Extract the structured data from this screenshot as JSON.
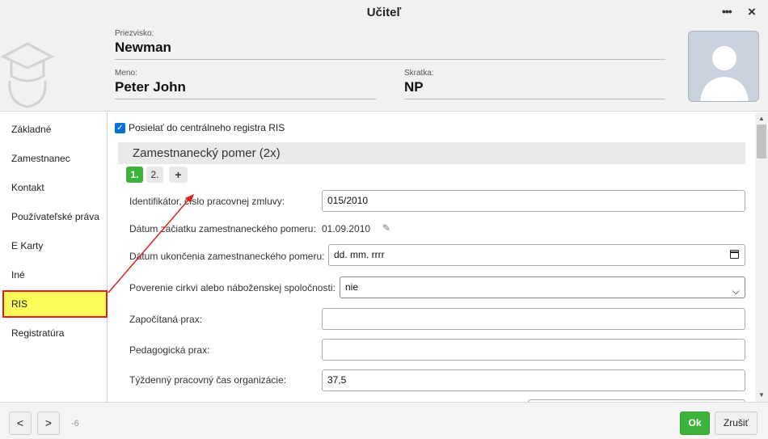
{
  "window": {
    "title": "Učiteľ",
    "more_icon": "more-dots-icon",
    "close_icon": "close-icon"
  },
  "header": {
    "surname": {
      "label": "Priezvisko:",
      "value": "Newman"
    },
    "name": {
      "label": "Meno:",
      "value": "Peter John"
    },
    "abbr": {
      "label": "Skratka:",
      "value": "NP"
    }
  },
  "sidebar": {
    "items": [
      {
        "label": "Základné"
      },
      {
        "label": "Zamestnanec"
      },
      {
        "label": "Kontakt"
      },
      {
        "label": "Používateľské práva"
      },
      {
        "label": "E Karty"
      },
      {
        "label": "Iné"
      },
      {
        "label": "RIS",
        "active": true
      },
      {
        "label": "Registratúra"
      }
    ],
    "highlight_color": "#fbfb5a",
    "highlight_border": "#e0201c"
  },
  "content": {
    "send_checkbox": {
      "label": "Posielať do centrálneho registra RIS",
      "checked": true
    },
    "section_title": "Zamestnanecký pomer (2x)",
    "pager": {
      "p1": "1.",
      "p2": "2.",
      "add": "+"
    },
    "fields": {
      "contract_id": {
        "label": "Identifikátor, číslo pracovnej zmluvy:",
        "value": "015/2010"
      },
      "start_date": {
        "label": "Dátum začiatku zamestnaneckého pomeru:",
        "value": "01.09.2010"
      },
      "end_date": {
        "label": "Dátum ukončenia zamestnaneckého pomeru:",
        "placeholder": "dd. mm. rrrr"
      },
      "church_mandate": {
        "label": "Poverenie cirkvi alebo náboženskej spoločnosti:",
        "value": "nie"
      },
      "credited_practice": {
        "label": "Započítaná prax:",
        "value": ""
      },
      "pedagogical_practice": {
        "label": "Pedagogická prax:",
        "value": ""
      },
      "weekly_hours": {
        "label": "Týždenný pracovný čas organizácie:",
        "value": "37,5"
      }
    }
  },
  "footer": {
    "prev_label": "<",
    "next_label": ">",
    "counter": "-6",
    "ok_label": "Ok",
    "cancel_label": "Zrušiť"
  },
  "accent": {
    "ok_green": "#3cb43c",
    "checkbox_blue": "#0a6fd6",
    "annotation_red": "#e0201c"
  }
}
